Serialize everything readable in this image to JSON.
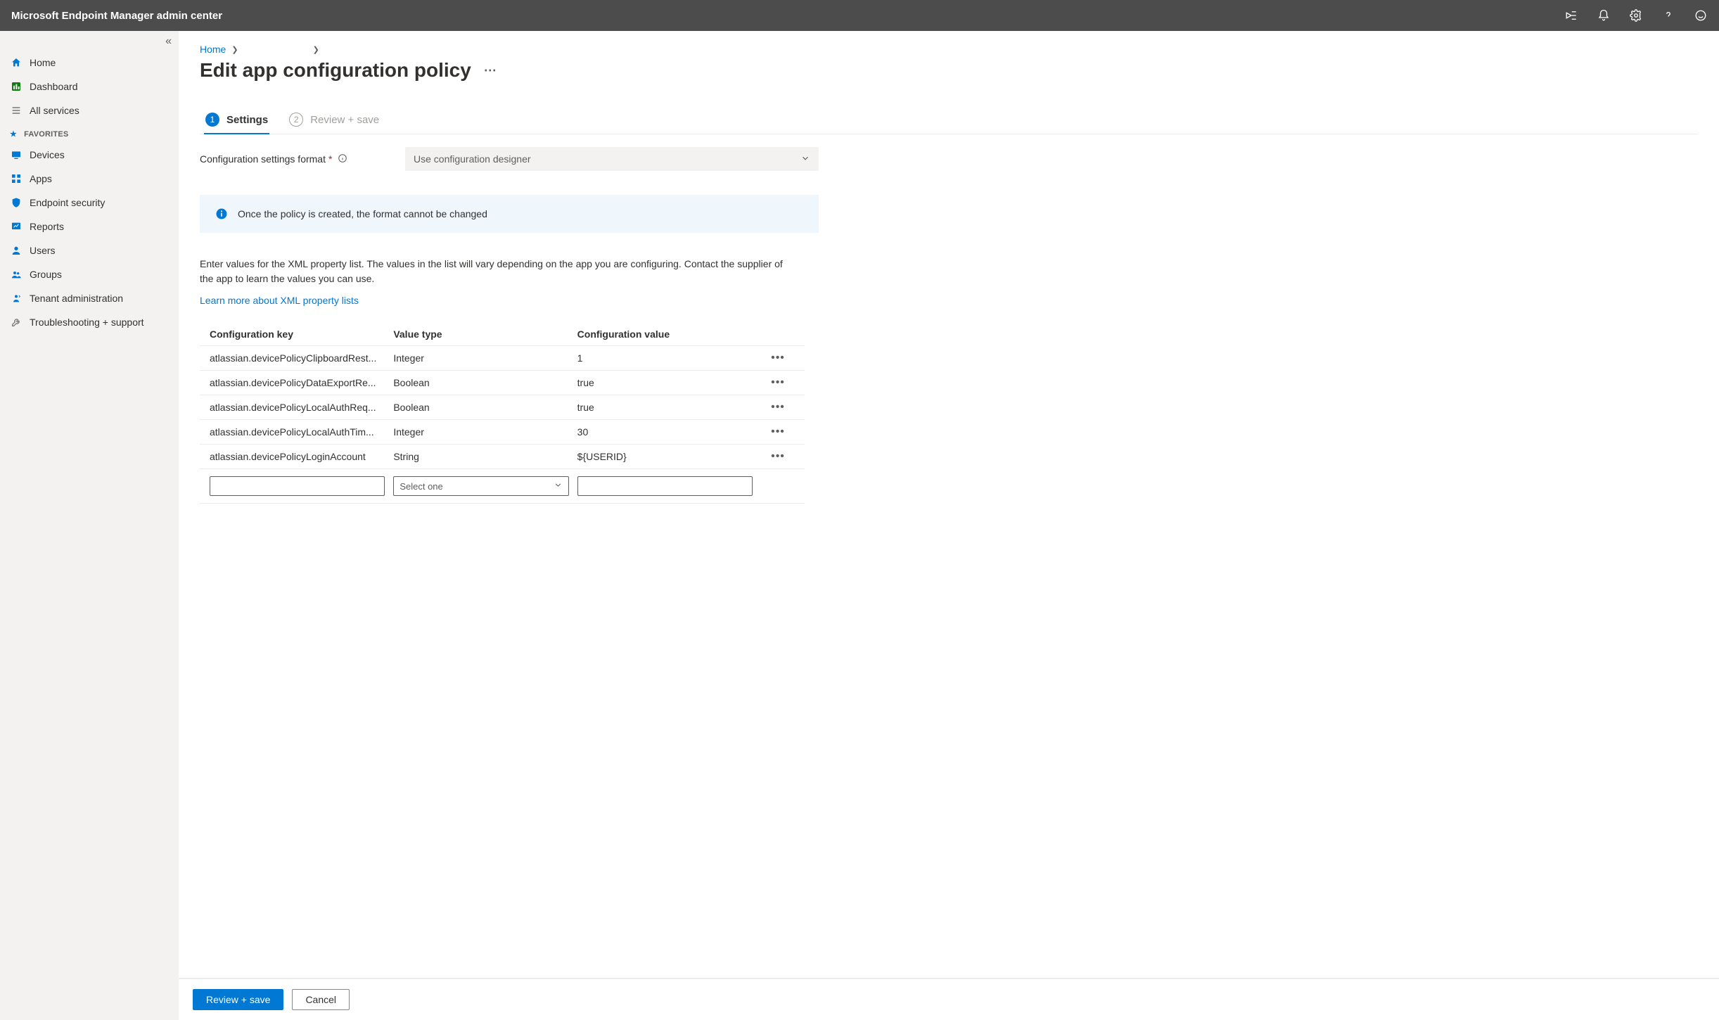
{
  "topbar": {
    "title": "Microsoft Endpoint Manager admin center"
  },
  "sidebar": {
    "items": [
      {
        "icon": "home-icon",
        "label": "Home"
      },
      {
        "icon": "dashboard-icon",
        "label": "Dashboard"
      },
      {
        "icon": "list-icon",
        "label": "All services"
      }
    ],
    "favorites_header": "FAVORITES",
    "favorites": [
      {
        "icon": "devices-icon",
        "label": "Devices"
      },
      {
        "icon": "apps-icon",
        "label": "Apps"
      },
      {
        "icon": "security-icon",
        "label": "Endpoint security"
      },
      {
        "icon": "reports-icon",
        "label": "Reports"
      },
      {
        "icon": "users-icon",
        "label": "Users"
      },
      {
        "icon": "groups-icon",
        "label": "Groups"
      },
      {
        "icon": "tenant-icon",
        "label": "Tenant administration"
      },
      {
        "icon": "troubleshoot-icon",
        "label": "Troubleshooting + support"
      }
    ]
  },
  "breadcrumb": {
    "home": "Home"
  },
  "page": {
    "title": "Edit app configuration policy"
  },
  "wizard": {
    "step1": {
      "num": "1",
      "label": "Settings"
    },
    "step2": {
      "num": "2",
      "label": "Review + save"
    }
  },
  "form": {
    "config_format_label": "Configuration settings format",
    "config_format_value": "Use configuration designer"
  },
  "callout": {
    "text": "Once the policy is created, the format cannot be changed"
  },
  "body_text": "Enter values for the XML property list. The values in the list will vary depending on the app you are configuring. Contact the supplier of the app to learn the values you can use.",
  "link_text": "Learn more about XML property lists",
  "table": {
    "headers": {
      "key": "Configuration key",
      "type": "Value type",
      "value": "Configuration value"
    },
    "rows": [
      {
        "key": "atlassian.devicePolicyClipboardRest...",
        "type": "Integer",
        "value": "1"
      },
      {
        "key": "atlassian.devicePolicyDataExportRe...",
        "type": "Boolean",
        "value": "true"
      },
      {
        "key": "atlassian.devicePolicyLocalAuthReq...",
        "type": "Boolean",
        "value": "true"
      },
      {
        "key": "atlassian.devicePolicyLocalAuthTim...",
        "type": "Integer",
        "value": "30"
      },
      {
        "key": "atlassian.devicePolicyLoginAccount",
        "type": "String",
        "value": "${USERID}"
      }
    ],
    "select_placeholder": "Select one"
  },
  "footer": {
    "primary": "Review + save",
    "cancel": "Cancel"
  }
}
